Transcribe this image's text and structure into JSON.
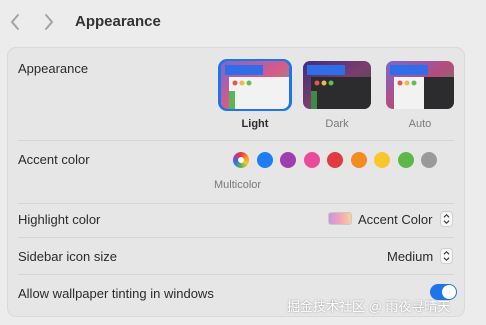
{
  "toolbar": {
    "back_icon": "chevron-left-icon",
    "forward_icon": "chevron-right-icon",
    "title": "Appearance"
  },
  "appearance": {
    "label": "Appearance",
    "options": [
      {
        "label": "Light",
        "selected": true
      },
      {
        "label": "Dark",
        "selected": false
      },
      {
        "label": "Auto",
        "selected": false
      }
    ]
  },
  "accent": {
    "label": "Accent color",
    "selected_label": "Multicolor",
    "colors": [
      "multicolor",
      "#1f7cf3",
      "#9d3fb0",
      "#ea4c9a",
      "#e33940",
      "#f78b1f",
      "#fbc62c",
      "#5cb947",
      "#9a9a9a"
    ]
  },
  "highlight": {
    "label": "Highlight color",
    "value": "Accent Color"
  },
  "sidebar_icon_size": {
    "label": "Sidebar icon size",
    "value": "Medium"
  },
  "wallpaper_tinting": {
    "label": "Allow wallpaper tinting in windows",
    "enabled": true
  },
  "watermark": "掘金技术社区 @ 雨夜寻晴天",
  "colors": {
    "accent": "#1e74ea",
    "background": "#ececec",
    "card": "#e6e6e6"
  }
}
